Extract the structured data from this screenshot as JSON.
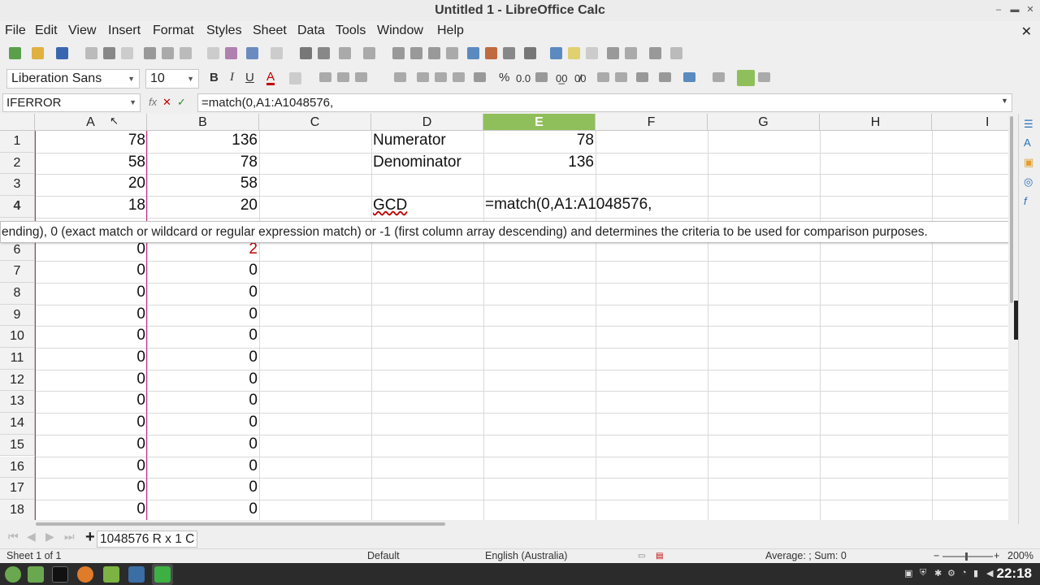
{
  "window": {
    "title": "Untitled 1 - LibreOffice Calc",
    "min": "–",
    "max": "▬",
    "close": "✕"
  },
  "menu": [
    "File",
    "Edit",
    "View",
    "Insert",
    "Format",
    "Styles",
    "Sheet",
    "Data",
    "Tools",
    "Window",
    "Help"
  ],
  "menu_close": "✕",
  "format_toolbar": {
    "font_name": "Liberation Sans",
    "font_size": "10",
    "bold": "B",
    "italic": "I",
    "underline": "U",
    "font_color": "A",
    "percent": "%",
    "number": "0.0",
    "decimals_add": "0̲0",
    "decimals_del": "0̸0"
  },
  "formula_bar": {
    "name_box": "IFERROR",
    "fx": "fx",
    "cancel": "✕",
    "accept": "✓",
    "content": "=match(0,A1:A1048576,"
  },
  "columns": [
    "A",
    "B",
    "C",
    "D",
    "E",
    "F",
    "G",
    "H",
    "I"
  ],
  "selected_column": "E",
  "rows": [
    "1",
    "2",
    "3",
    "4",
    "5",
    "6",
    "7",
    "8",
    "9",
    "10",
    "11",
    "12",
    "13",
    "14",
    "15",
    "16",
    "17",
    "18"
  ],
  "selected_row": "4",
  "cells": {
    "A": [
      "78",
      "58",
      "20",
      "18",
      "",
      "0",
      "0",
      "0",
      "0",
      "0",
      "0",
      "0",
      "0",
      "0",
      "0",
      "0",
      "0",
      "0"
    ],
    "B": [
      "136",
      "78",
      "58",
      "20",
      "",
      "2",
      "0",
      "0",
      "0",
      "0",
      "0",
      "0",
      "0",
      "0",
      "0",
      "0",
      "0",
      "0"
    ],
    "D1": "Numerator",
    "E1": "78",
    "D2": "Denominator",
    "E2": "136",
    "D4": "GCD",
    "E4": "=match(0,A1:A1048576,"
  },
  "tooltip": "ending), 0 (exact match or wildcard or regular expression match) or -1 (first column array descending) and determines the criteria to be used for comparison purposes.",
  "selection_tip": "1048576 R  x 1 C",
  "status": {
    "sheet": "Sheet 1 of 1",
    "style": "Default",
    "language": "English (Australia)",
    "sum": "Average: ; Sum: 0",
    "zoom": "200%"
  },
  "taskbar": {
    "clock": "22:18"
  },
  "colors": {
    "selected_header": "#8fbf5a",
    "selection_border": "#c02a80",
    "error_red": "#c00000"
  }
}
